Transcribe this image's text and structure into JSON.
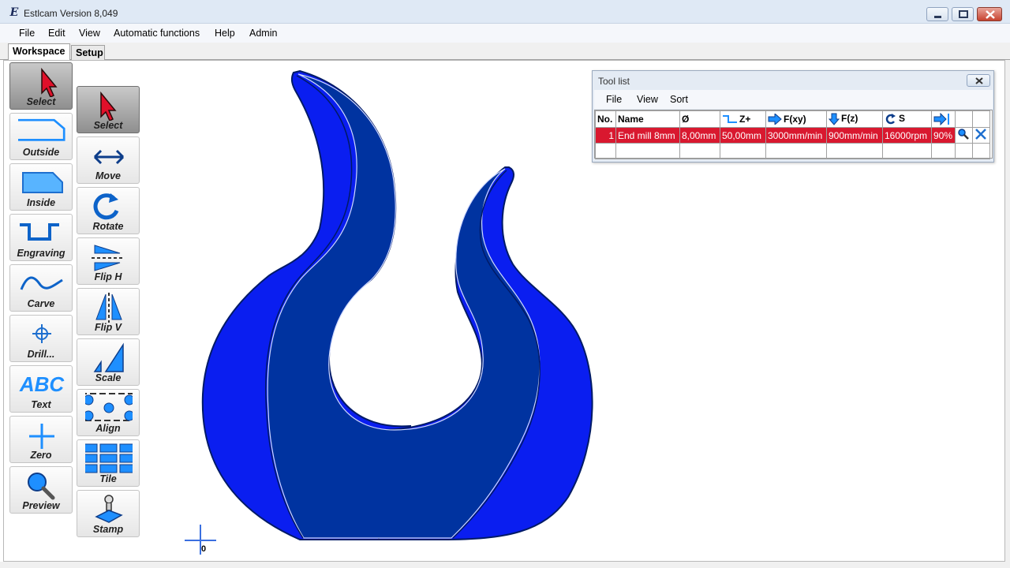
{
  "window": {
    "title": "Estlcam Version 8,049",
    "icon_glyph": "E"
  },
  "menu": {
    "items": [
      "File",
      "Edit",
      "View",
      "Automatic functions",
      "Help",
      "Admin"
    ]
  },
  "tabs": [
    "Workspace",
    "Setup"
  ],
  "toolbar_left": [
    {
      "label": "Select",
      "icon": "cursor-arrow-icon",
      "active": true
    },
    {
      "label": "Outside",
      "icon": "outside-contour-icon"
    },
    {
      "label": "Inside",
      "icon": "inside-contour-icon"
    },
    {
      "label": "Engraving",
      "icon": "engraving-icon"
    },
    {
      "label": "Carve",
      "icon": "carve-icon"
    },
    {
      "label": "Drill...",
      "icon": "drill-icon"
    },
    {
      "label": "Text",
      "icon": "text-abc-icon",
      "glyph": "ABC"
    },
    {
      "label": "Zero",
      "icon": "zero-cross-icon"
    },
    {
      "label": "Preview",
      "icon": "magnifier-icon"
    }
  ],
  "toolbar_right": [
    {
      "label": "Select",
      "icon": "cursor-arrow-icon",
      "active": true
    },
    {
      "label": "Move",
      "icon": "move-arrows-icon"
    },
    {
      "label": "Rotate",
      "icon": "rotate-icon"
    },
    {
      "label": "Flip H",
      "icon": "flip-horizontal-icon"
    },
    {
      "label": "Flip V",
      "icon": "flip-vertical-icon"
    },
    {
      "label": "Scale",
      "icon": "scale-icon"
    },
    {
      "label": "Align",
      "icon": "align-icon"
    },
    {
      "label": "Tile",
      "icon": "tile-icon"
    },
    {
      "label": "Stamp",
      "icon": "stamp-icon"
    }
  ],
  "canvas": {
    "zero_label": "0",
    "colors": {
      "outer": "#0a1ef0",
      "inner": "#0033a0",
      "outline": "#001a66"
    }
  },
  "tool_list": {
    "title": "Tool list",
    "menu": [
      "File",
      "View",
      "Sort"
    ],
    "columns": [
      "No.",
      "Name",
      "Ø",
      "Z+",
      "F(xy)",
      "F(z)",
      "S",
      "",
      "",
      ""
    ],
    "rows": [
      {
        "no": "1",
        "name": "End mill 8mm",
        "diameter": "8,00mm",
        "z_plus": "50,00mm",
        "f_xy": "3000mm/min",
        "f_z": "900mm/min",
        "s": "16000rpm",
        "pct": "90%"
      }
    ],
    "selected_color": "#d9182f"
  }
}
